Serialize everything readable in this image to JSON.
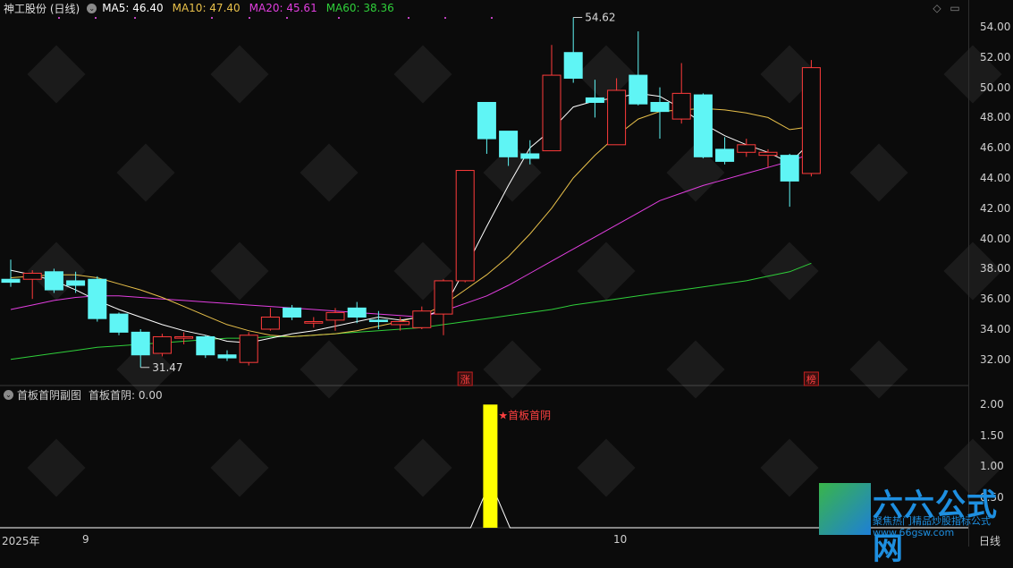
{
  "header": {
    "stock_name": "神工股份 (日线)",
    "ma5": "MA5: 46.40",
    "ma10": "MA10: 47.40",
    "ma20": "MA20: 45.61",
    "ma60": "MA60: 38.36",
    "toggle_glyph": "⌄"
  },
  "top_icons": [
    "◇",
    "▭"
  ],
  "sub_header": {
    "title": "首板首阴副图",
    "value": "首板首阴: 0.00"
  },
  "colors": {
    "up": "#ff3b3b",
    "down": "#5ff5f5",
    "ma5": "#ffffff",
    "ma10": "#e8c04a",
    "ma20": "#e23ee0",
    "ma60": "#2fcf3a",
    "signal": "#ffff00",
    "grid": "#2a2a2a"
  },
  "price_axis": {
    "ticks": [
      "54.00",
      "52.00",
      "50.00",
      "48.00",
      "46.00",
      "44.00",
      "42.00",
      "40.00",
      "38.00",
      "36.00",
      "34.00",
      "32.00"
    ]
  },
  "sub_axis": {
    "ticks": [
      "2.00",
      "1.50",
      "1.00",
      "0.50"
    ]
  },
  "x_axis": {
    "labels": [
      "2025年",
      "9",
      "10",
      "日线"
    ]
  },
  "annotations": {
    "high_label": "54.62",
    "low_label": "31.47",
    "zhang_tag": "涨",
    "bang_tag": "榜",
    "signal_label": "★首板首阴"
  },
  "chart_data": {
    "type": "candlestick",
    "ylim": [
      31,
      55
    ],
    "candles": [
      {
        "o": 37.3,
        "c": 37.1,
        "h": 38.6,
        "l": 36.8
      },
      {
        "o": 37.3,
        "c": 37.7,
        "h": 37.9,
        "l": 36.0
      },
      {
        "o": 37.8,
        "c": 36.6,
        "h": 38.0,
        "l": 36.4
      },
      {
        "o": 37.2,
        "c": 36.9,
        "h": 37.8,
        "l": 36.4
      },
      {
        "o": 37.3,
        "c": 34.7,
        "h": 37.5,
        "l": 34.5
      },
      {
        "o": 35.0,
        "c": 33.8,
        "h": 35.1,
        "l": 33.6
      },
      {
        "o": 33.8,
        "c": 32.3,
        "h": 34.0,
        "l": 31.47
      },
      {
        "o": 32.4,
        "c": 33.5,
        "h": 33.7,
        "l": 32.2
      },
      {
        "o": 33.4,
        "c": 33.5,
        "h": 33.8,
        "l": 33.0
      },
      {
        "o": 33.5,
        "c": 32.3,
        "h": 33.6,
        "l": 32.1
      },
      {
        "o": 32.3,
        "c": 32.1,
        "h": 32.6,
        "l": 31.9
      },
      {
        "o": 31.8,
        "c": 33.6,
        "h": 33.8,
        "l": 31.6
      },
      {
        "o": 34.0,
        "c": 34.8,
        "h": 35.4,
        "l": 33.9
      },
      {
        "o": 35.4,
        "c": 34.8,
        "h": 35.6,
        "l": 34.6
      },
      {
        "o": 34.4,
        "c": 34.5,
        "h": 34.8,
        "l": 34.1
      },
      {
        "o": 34.6,
        "c": 35.1,
        "h": 35.4,
        "l": 33.9
      },
      {
        "o": 35.4,
        "c": 34.8,
        "h": 35.8,
        "l": 34.4
      },
      {
        "o": 34.6,
        "c": 34.5,
        "h": 35.2,
        "l": 34.0
      },
      {
        "o": 34.3,
        "c": 34.5,
        "h": 34.8,
        "l": 33.9
      },
      {
        "o": 34.1,
        "c": 35.2,
        "h": 35.5,
        "l": 34.0
      },
      {
        "o": 35.0,
        "c": 37.2,
        "h": 37.3,
        "l": 33.6
      },
      {
        "o": 37.2,
        "c": 44.5,
        "h": 44.5,
        "l": 37.1
      },
      {
        "o": 49.0,
        "c": 46.6,
        "h": 49.0,
        "l": 45.6
      },
      {
        "o": 47.1,
        "c": 45.4,
        "h": 47.1,
        "l": 44.8
      },
      {
        "o": 45.6,
        "c": 45.3,
        "h": 46.5,
        "l": 44.9
      },
      {
        "o": 45.8,
        "c": 50.8,
        "h": 52.8,
        "l": 45.8
      },
      {
        "o": 52.3,
        "c": 50.6,
        "h": 54.62,
        "l": 50.3
      },
      {
        "o": 49.3,
        "c": 49.0,
        "h": 50.5,
        "l": 48.0
      },
      {
        "o": 46.2,
        "c": 49.8,
        "h": 50.6,
        "l": 46.2
      },
      {
        "o": 50.8,
        "c": 48.9,
        "h": 53.7,
        "l": 48.8
      },
      {
        "o": 49.0,
        "c": 48.4,
        "h": 50.0,
        "l": 46.6
      },
      {
        "o": 47.9,
        "c": 49.6,
        "h": 51.6,
        "l": 47.6
      },
      {
        "o": 49.5,
        "c": 45.4,
        "h": 49.6,
        "l": 45.3
      },
      {
        "o": 45.9,
        "c": 45.1,
        "h": 46.7,
        "l": 44.9
      },
      {
        "o": 45.7,
        "c": 46.2,
        "h": 46.6,
        "l": 45.4
      },
      {
        "o": 45.5,
        "c": 45.7,
        "h": 45.9,
        "l": 44.7
      },
      {
        "o": 45.5,
        "c": 43.8,
        "h": 45.6,
        "l": 42.1
      },
      {
        "o": 44.3,
        "c": 51.3,
        "h": 51.8,
        "l": 44.1
      }
    ],
    "ma5": [
      37.9,
      37.6,
      37.2,
      36.6,
      35.9,
      35.3,
      34.8,
      34.3,
      33.9,
      33.6,
      33.2,
      33.1,
      33.4,
      33.7,
      33.9,
      34.2,
      34.5,
      34.8,
      34.6,
      34.8,
      35.3,
      38.0,
      40.8,
      43.5,
      46.0,
      47.2,
      48.7,
      49.1,
      49.3,
      49.6,
      49.4,
      48.6,
      47.6,
      46.8,
      46.2,
      45.7,
      45.0,
      46.4
    ],
    "ma10": [
      37.4,
      37.5,
      37.6,
      37.6,
      37.4,
      37.0,
      36.6,
      36.1,
      35.5,
      34.9,
      34.3,
      33.9,
      33.6,
      33.5,
      33.6,
      33.7,
      33.9,
      34.2,
      34.5,
      34.9,
      35.6,
      36.6,
      37.6,
      38.8,
      40.3,
      42.0,
      44.0,
      45.5,
      46.8,
      47.9,
      48.4,
      48.5,
      48.6,
      48.5,
      48.3,
      48.0,
      47.2,
      47.4
    ],
    "ma20": [
      35.3,
      35.6,
      35.9,
      36.1,
      36.2,
      36.2,
      36.1,
      36.0,
      35.9,
      35.8,
      35.7,
      35.6,
      35.5,
      35.4,
      35.3,
      35.2,
      35.1,
      35.0,
      34.9,
      34.8,
      35.2,
      35.7,
      36.2,
      36.9,
      37.7,
      38.5,
      39.3,
      40.1,
      40.9,
      41.7,
      42.5,
      43.0,
      43.5,
      43.9,
      44.3,
      44.7,
      45.1,
      45.61
    ],
    "ma60": [
      32.0,
      32.2,
      32.4,
      32.6,
      32.8,
      32.9,
      33.0,
      33.1,
      33.2,
      33.3,
      33.4,
      33.4,
      33.5,
      33.5,
      33.6,
      33.7,
      33.8,
      33.9,
      34.0,
      34.1,
      34.3,
      34.5,
      34.7,
      34.9,
      35.1,
      35.3,
      35.6,
      35.8,
      36.0,
      36.2,
      36.4,
      36.6,
      36.8,
      37.0,
      37.2,
      37.5,
      37.8,
      38.36
    ],
    "signal": {
      "index": 22,
      "bar_value": 2.0,
      "peak_value": 0.75
    },
    "sub_ylim": [
      0,
      2.2
    ]
  }
}
